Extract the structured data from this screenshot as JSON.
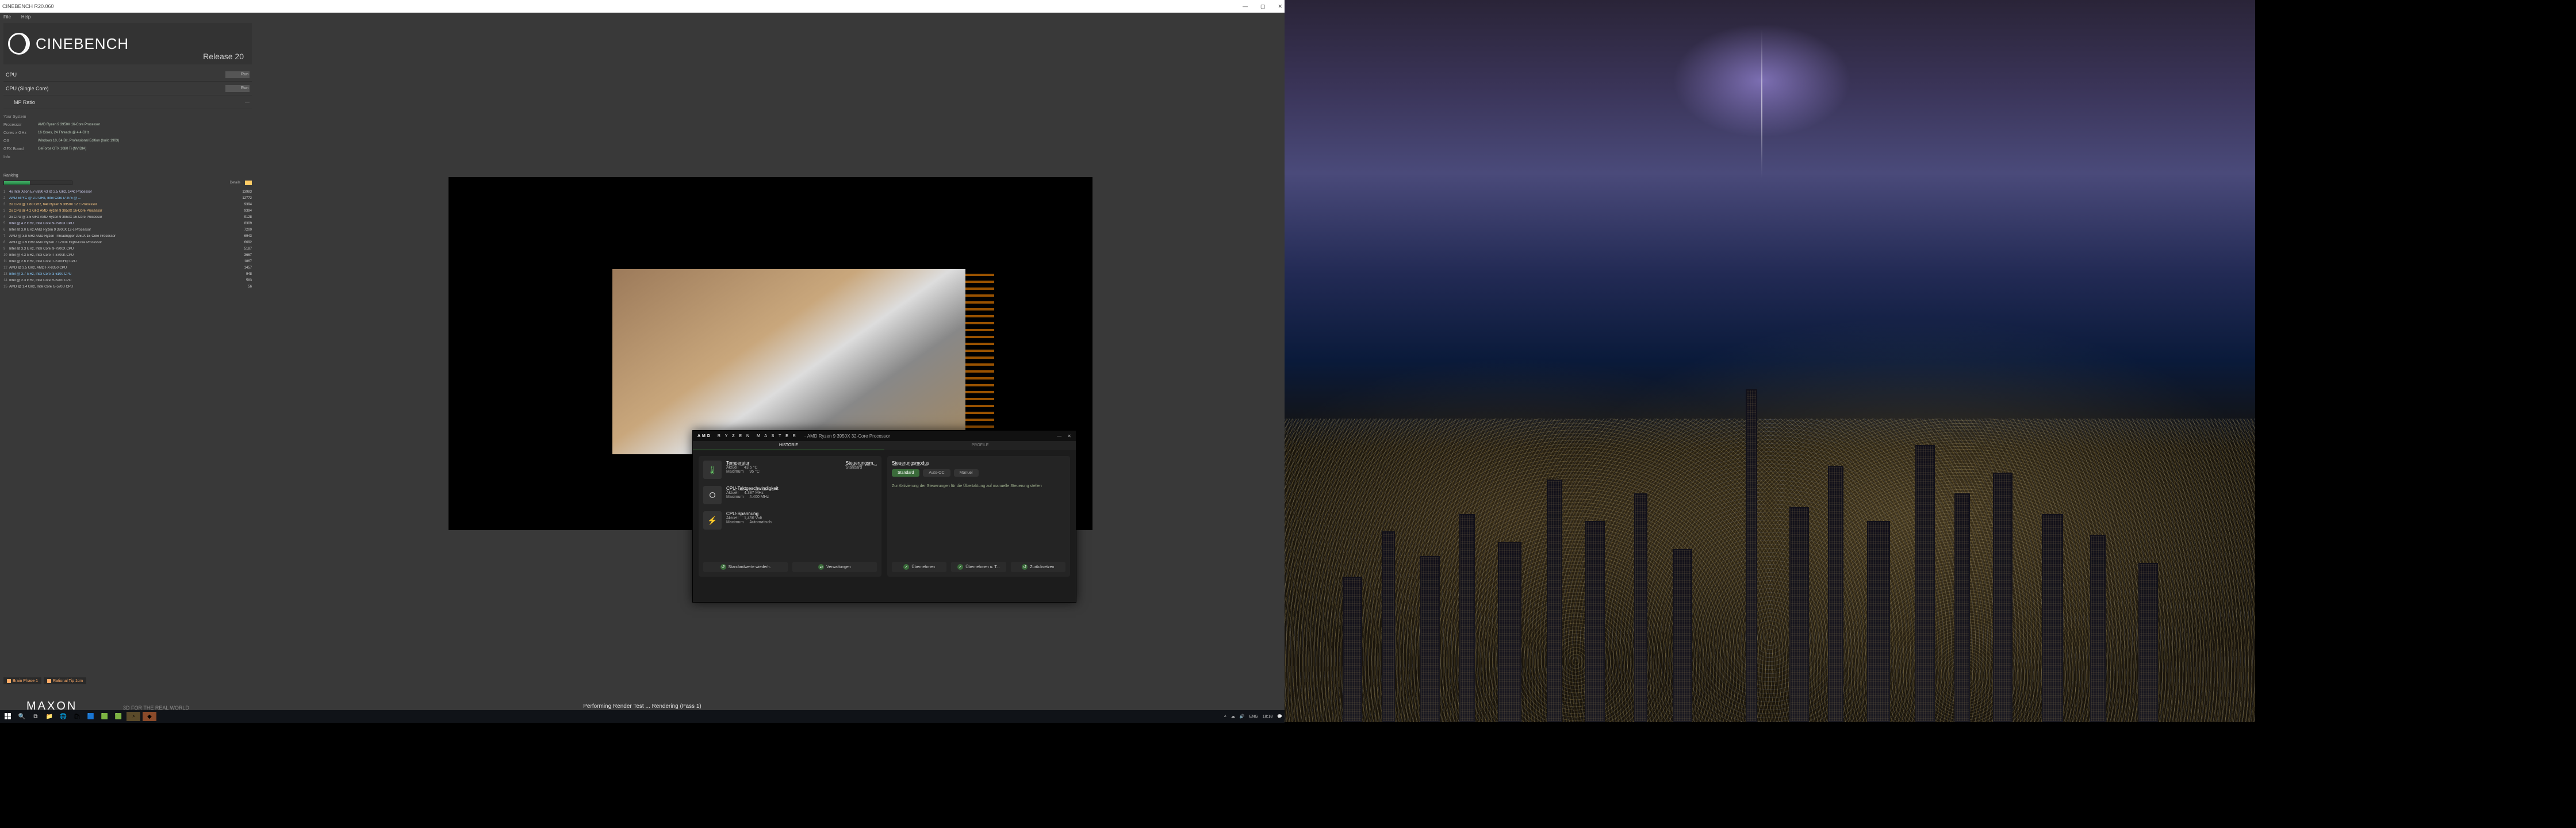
{
  "window": {
    "title": "CINEBENCH R20.060",
    "controls": {
      "min": "—",
      "max": "▢",
      "close": "✕"
    }
  },
  "menu": {
    "file": "File",
    "help": "Help"
  },
  "logo": {
    "name": "CINEBENCH",
    "release": "Release 20"
  },
  "tests": {
    "cpu": {
      "label": "CPU",
      "btn": "Run"
    },
    "single": {
      "label": "CPU (Single Core)",
      "btn": "Run"
    },
    "mp": {
      "label": "MP Ratio",
      "val": "—"
    }
  },
  "system": {
    "head": "Your System",
    "rows": [
      {
        "k": "Processor",
        "v": "AMD Ryzen 9 3950X 16-Core Processor"
      },
      {
        "k": "Cores x GHz",
        "v": "16 Cores, 24 Threads @ 4.4 GHz"
      },
      {
        "k": "OS",
        "v": "Windows 10, 64 Bit, Professional Edition (build 1903)"
      },
      {
        "k": "GFX Board",
        "v": "GeForce GTX 1080 Ti (NVIDIA)"
      },
      {
        "k": "Info",
        "v": ""
      }
    ]
  },
  "ranking": {
    "head": "Ranking",
    "details": "Details",
    "rows": [
      {
        "n": "1",
        "d": "4x Intel Xeon E7-8890 v3 @ 2.5 GHz, 144c Processor",
        "s": "13983",
        "c": 0
      },
      {
        "n": "2",
        "d": "AMD EPYC @ 2.0 GHz, Intel Core i7-975 @ ...",
        "s": "12772",
        "c": 2
      },
      {
        "n": "3",
        "d": "2x CPU @ 1.80 GHz, 64c Ryzen 9 3950X 12 c Processor",
        "s": "9394",
        "c": 1
      },
      {
        "n": "3",
        "d": "2x CPU @ 4.2 GHz AMD Ryzen 9 3950X 16-Core Processor",
        "s": "9394",
        "c": 1
      },
      {
        "n": "4",
        "d": "2x CPU @ 3.5 GHz AMD Ryzen 9 3950X 16-Core Processor",
        "s": "9128",
        "c": 3
      },
      {
        "n": "5",
        "d": "Intel @ 4.2 GHz, Intel Core i9-7980X CPU",
        "s": "8309",
        "c": 0
      },
      {
        "n": "6",
        "d": "Intel @ 3.0 GHz AMD Ryzen 9 3900X 12-c Processor",
        "s": "7200",
        "c": 3
      },
      {
        "n": "7",
        "d": "AMD @ 3.8 GHz AMD Ryzen Threadripper 2950X 16-Core Processor",
        "s": "6943",
        "c": 3
      },
      {
        "n": "8",
        "d": "AMD @ 2.9 GHz AMD Ryzen 7 1700X Eight-Core Processor",
        "s": "6692",
        "c": 3
      },
      {
        "n": "9",
        "d": "Intel @ 3.3 GHz, Intel Core i9-7900X CPU",
        "s": "5187",
        "c": 3
      },
      {
        "n": "10",
        "d": "Intel @ 4.3 GHz, Intel Core i7-8700K CPU",
        "s": "3667",
        "c": 3
      },
      {
        "n": "11",
        "d": "Intel @ 2.6 GHz, Intel Core i7-6700HQ CPU",
        "s": "1867",
        "c": 3
      },
      {
        "n": "12",
        "d": "AMD @ 3.5 GHz, AMD FX-8350 CPU",
        "s": "1457",
        "c": 3
      },
      {
        "n": "13",
        "d": "Intel @ 3.7 GHz, Intel Core i3-6100 CPU",
        "s": "948",
        "c": 2
      },
      {
        "n": "14",
        "d": "Intel @ 2.3 GHz, Intel Core i5-6200 CPU",
        "s": "583",
        "c": 3
      },
      {
        "n": "15",
        "d": "AMD @ 1.4 GHz, Intel Core i5-520U CPU",
        "s": "56",
        "c": 3
      }
    ]
  },
  "bottom": {
    "brainphase": "Brain Phase 1",
    "rational": "Rational Tip 1cm"
  },
  "maxon": {
    "name": "MAXON",
    "tag": "3D FOR THE REAL WORLD"
  },
  "status": "Performing Render Test ... Rendering (Pass 1)",
  "ryzen": {
    "brand": "AMDク  R Y Z E N   M A S T E R",
    "cpu": "AMD Ryzen 9 3950X 32-Core Processor",
    "tabs": {
      "history": "HISTORIE",
      "profile": "PROFILE"
    },
    "metrics": {
      "temp": {
        "title": "Temperatur",
        "l1k": "Aktuell",
        "l1v": "43,5 °C",
        "l2k": "Maximum",
        "l2v": "95 °C",
        "icon": "🌡"
      },
      "clock": {
        "title": "CPU-Taktgeschwindigkeit",
        "l1k": "Aktuell",
        "l1v": "4.387  MHz",
        "l2k": "Maximum",
        "l2v": "4.400  MHz",
        "icon": "⭘"
      },
      "volt": {
        "title": "CPU-Spannung",
        "l1k": "Aktuell",
        "l1v": "1,456  Volt",
        "l2k": "Maximum",
        "l2v": "Automatisch",
        "icon": "⚡"
      },
      "control": {
        "title": "Steuerungsm...",
        "sub": "Standard"
      }
    },
    "profile": {
      "mode": "Steuerungsmodus",
      "chips": [
        "Standard",
        "Auto-OC",
        "Manuel"
      ],
      "active": 0,
      "note": "Zur Aktivierung der Steuerungen für die Übertaktung auf manuelle Steuerung stellen"
    },
    "buttons": {
      "reset": "Standardwerte wiederh.",
      "manage": "Verwaltungen",
      "apply": "Übernehmen",
      "apptest": "Übernehmen u. T...",
      "revert": "Zurücksetzen"
    }
  },
  "taskbar": {
    "tray": {
      "net": "☁",
      "vol": "🔊",
      "lang": "ENG",
      "time": "18:18",
      "notif": "💬"
    }
  }
}
